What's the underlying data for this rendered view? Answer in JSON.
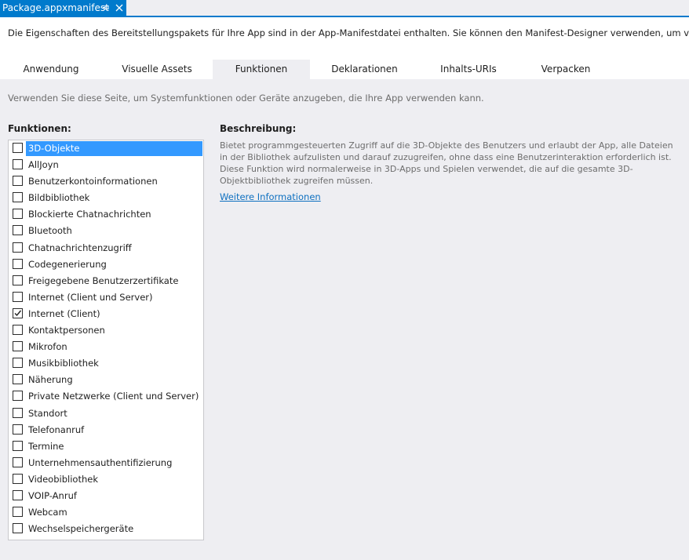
{
  "document_tab": {
    "title": "Package.appxmanifest",
    "pin_icon": "pin-icon",
    "close_icon": "close-icon"
  },
  "intro_text": "Die Eigenschaften des Bereitstellungspakets für Ihre App sind in der App-Manifestdatei enthalten. Sie können den Manifest-Designer verwenden, um verschiedene Eig",
  "tabs": [
    {
      "label": "Anwendung"
    },
    {
      "label": "Visuelle Assets"
    },
    {
      "label": "Funktionen",
      "active": true
    },
    {
      "label": "Deklarationen"
    },
    {
      "label": "Inhalts-URIs"
    },
    {
      "label": "Verpacken"
    }
  ],
  "page_description": "Verwenden Sie diese Seite, um Systemfunktionen oder Geräte anzugeben, die Ihre App verwenden kann.",
  "capabilities_header": "Funktionen:",
  "capabilities": [
    {
      "label": "3D-Objekte",
      "checked": false,
      "selected": true
    },
    {
      "label": "AllJoyn",
      "checked": false
    },
    {
      "label": "Benutzerkontoinformationen",
      "checked": false
    },
    {
      "label": "Bildbibliothek",
      "checked": false
    },
    {
      "label": "Blockierte Chatnachrichten",
      "checked": false
    },
    {
      "label": "Bluetooth",
      "checked": false
    },
    {
      "label": "Chatnachrichtenzugriff",
      "checked": false
    },
    {
      "label": "Codegenerierung",
      "checked": false
    },
    {
      "label": "Freigegebene Benutzerzertifikate",
      "checked": false
    },
    {
      "label": "Internet (Client und Server)",
      "checked": false
    },
    {
      "label": "Internet (Client)",
      "checked": true
    },
    {
      "label": "Kontaktpersonen",
      "checked": false
    },
    {
      "label": "Mikrofon",
      "checked": false
    },
    {
      "label": "Musikbibliothek",
      "checked": false
    },
    {
      "label": "Näherung",
      "checked": false
    },
    {
      "label": "Private Netzwerke (Client und Server)",
      "checked": false
    },
    {
      "label": "Standort",
      "checked": false
    },
    {
      "label": "Telefonanruf",
      "checked": false
    },
    {
      "label": "Termine",
      "checked": false
    },
    {
      "label": "Unternehmensauthentifizierung",
      "checked": false
    },
    {
      "label": "Videobibliothek",
      "checked": false
    },
    {
      "label": "VOIP-Anruf",
      "checked": false
    },
    {
      "label": "Webcam",
      "checked": false
    },
    {
      "label": "Wechselspeichergeräte",
      "checked": false
    }
  ],
  "description_header": "Beschreibung:",
  "description_text": "Bietet programmgesteuerten Zugriff auf die 3D-Objekte des Benutzers und erlaubt der App, alle Dateien in der Bibliothek aufzulisten und darauf zuzugreifen, ohne dass eine Benutzerinteraktion erforderlich ist. Diese Funktion wird normalerweise in 3D-Apps und Spielen verwendet, die auf die gesamte 3D-Objektbibliothek zugreifen müssen.",
  "more_info_link": "Weitere Informationen",
  "colors": {
    "accent": "#007acc",
    "selection": "#3399ff",
    "link": "#0e70c0",
    "background": "#eeeef2"
  }
}
